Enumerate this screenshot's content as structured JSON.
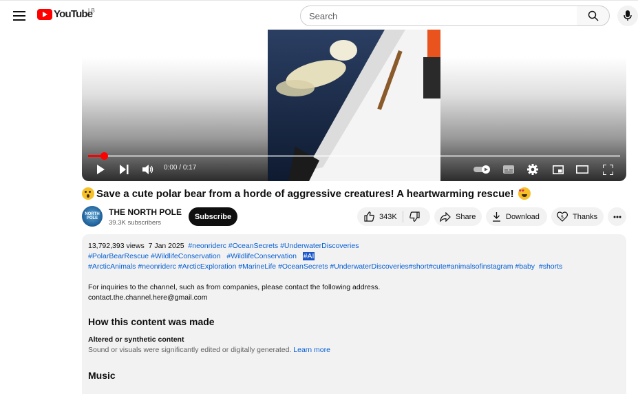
{
  "header": {
    "logo_text": "YouTube",
    "country_code": "LB",
    "search_placeholder": "Search"
  },
  "player": {
    "time_current": "0:00",
    "time_separator": " / ",
    "time_total": "0:17",
    "progress_fraction": 0.03
  },
  "video": {
    "title": "Save a cute polar bear from a horde of aggressive creatures! A heartwarming rescue!"
  },
  "channel": {
    "name": "THE NORTH POLE",
    "subscribers": "39.3K subscribers",
    "avatar_text": "NORTH POLE",
    "subscribe_label": "Subscribe"
  },
  "actions": {
    "like_count": "343K",
    "share_label": "Share",
    "download_label": "Download",
    "thanks_label": "Thanks"
  },
  "description": {
    "views": "13,792,393 views",
    "date": "7 Jan 2025",
    "line1_tags": [
      "#neonriderc",
      "#OceanSecrets",
      "#UnderwaterDiscoveries"
    ],
    "line2_tags": [
      "#PolarBearRescue",
      "#WildlifeConservation",
      "#WildlifeConservation"
    ],
    "highlighted_tag": "#AI",
    "line3_tags": [
      "#ArcticAnimals",
      "#neonriderc",
      "#ArcticExploration",
      "#MarineLife",
      "#OceanSecrets",
      "#UnderwaterDiscoveries#short#cute#animalsofinstagram",
      "#baby",
      "#shorts"
    ],
    "inquiry_text": "For inquiries to the channel, such as from companies, please contact the following address.",
    "email": "contact.the.channel.here@gmail.com",
    "how_made_heading": "How this content was made",
    "altered_label": "Altered or synthetic content",
    "altered_desc": "Sound or visuals were significantly edited or digitally generated.",
    "learn_more": "Learn more",
    "music_heading": "Music"
  },
  "colors": {
    "brand_red": "#ff0000",
    "link_blue": "#065fd4",
    "highlight_blue": "#1a56c8"
  }
}
